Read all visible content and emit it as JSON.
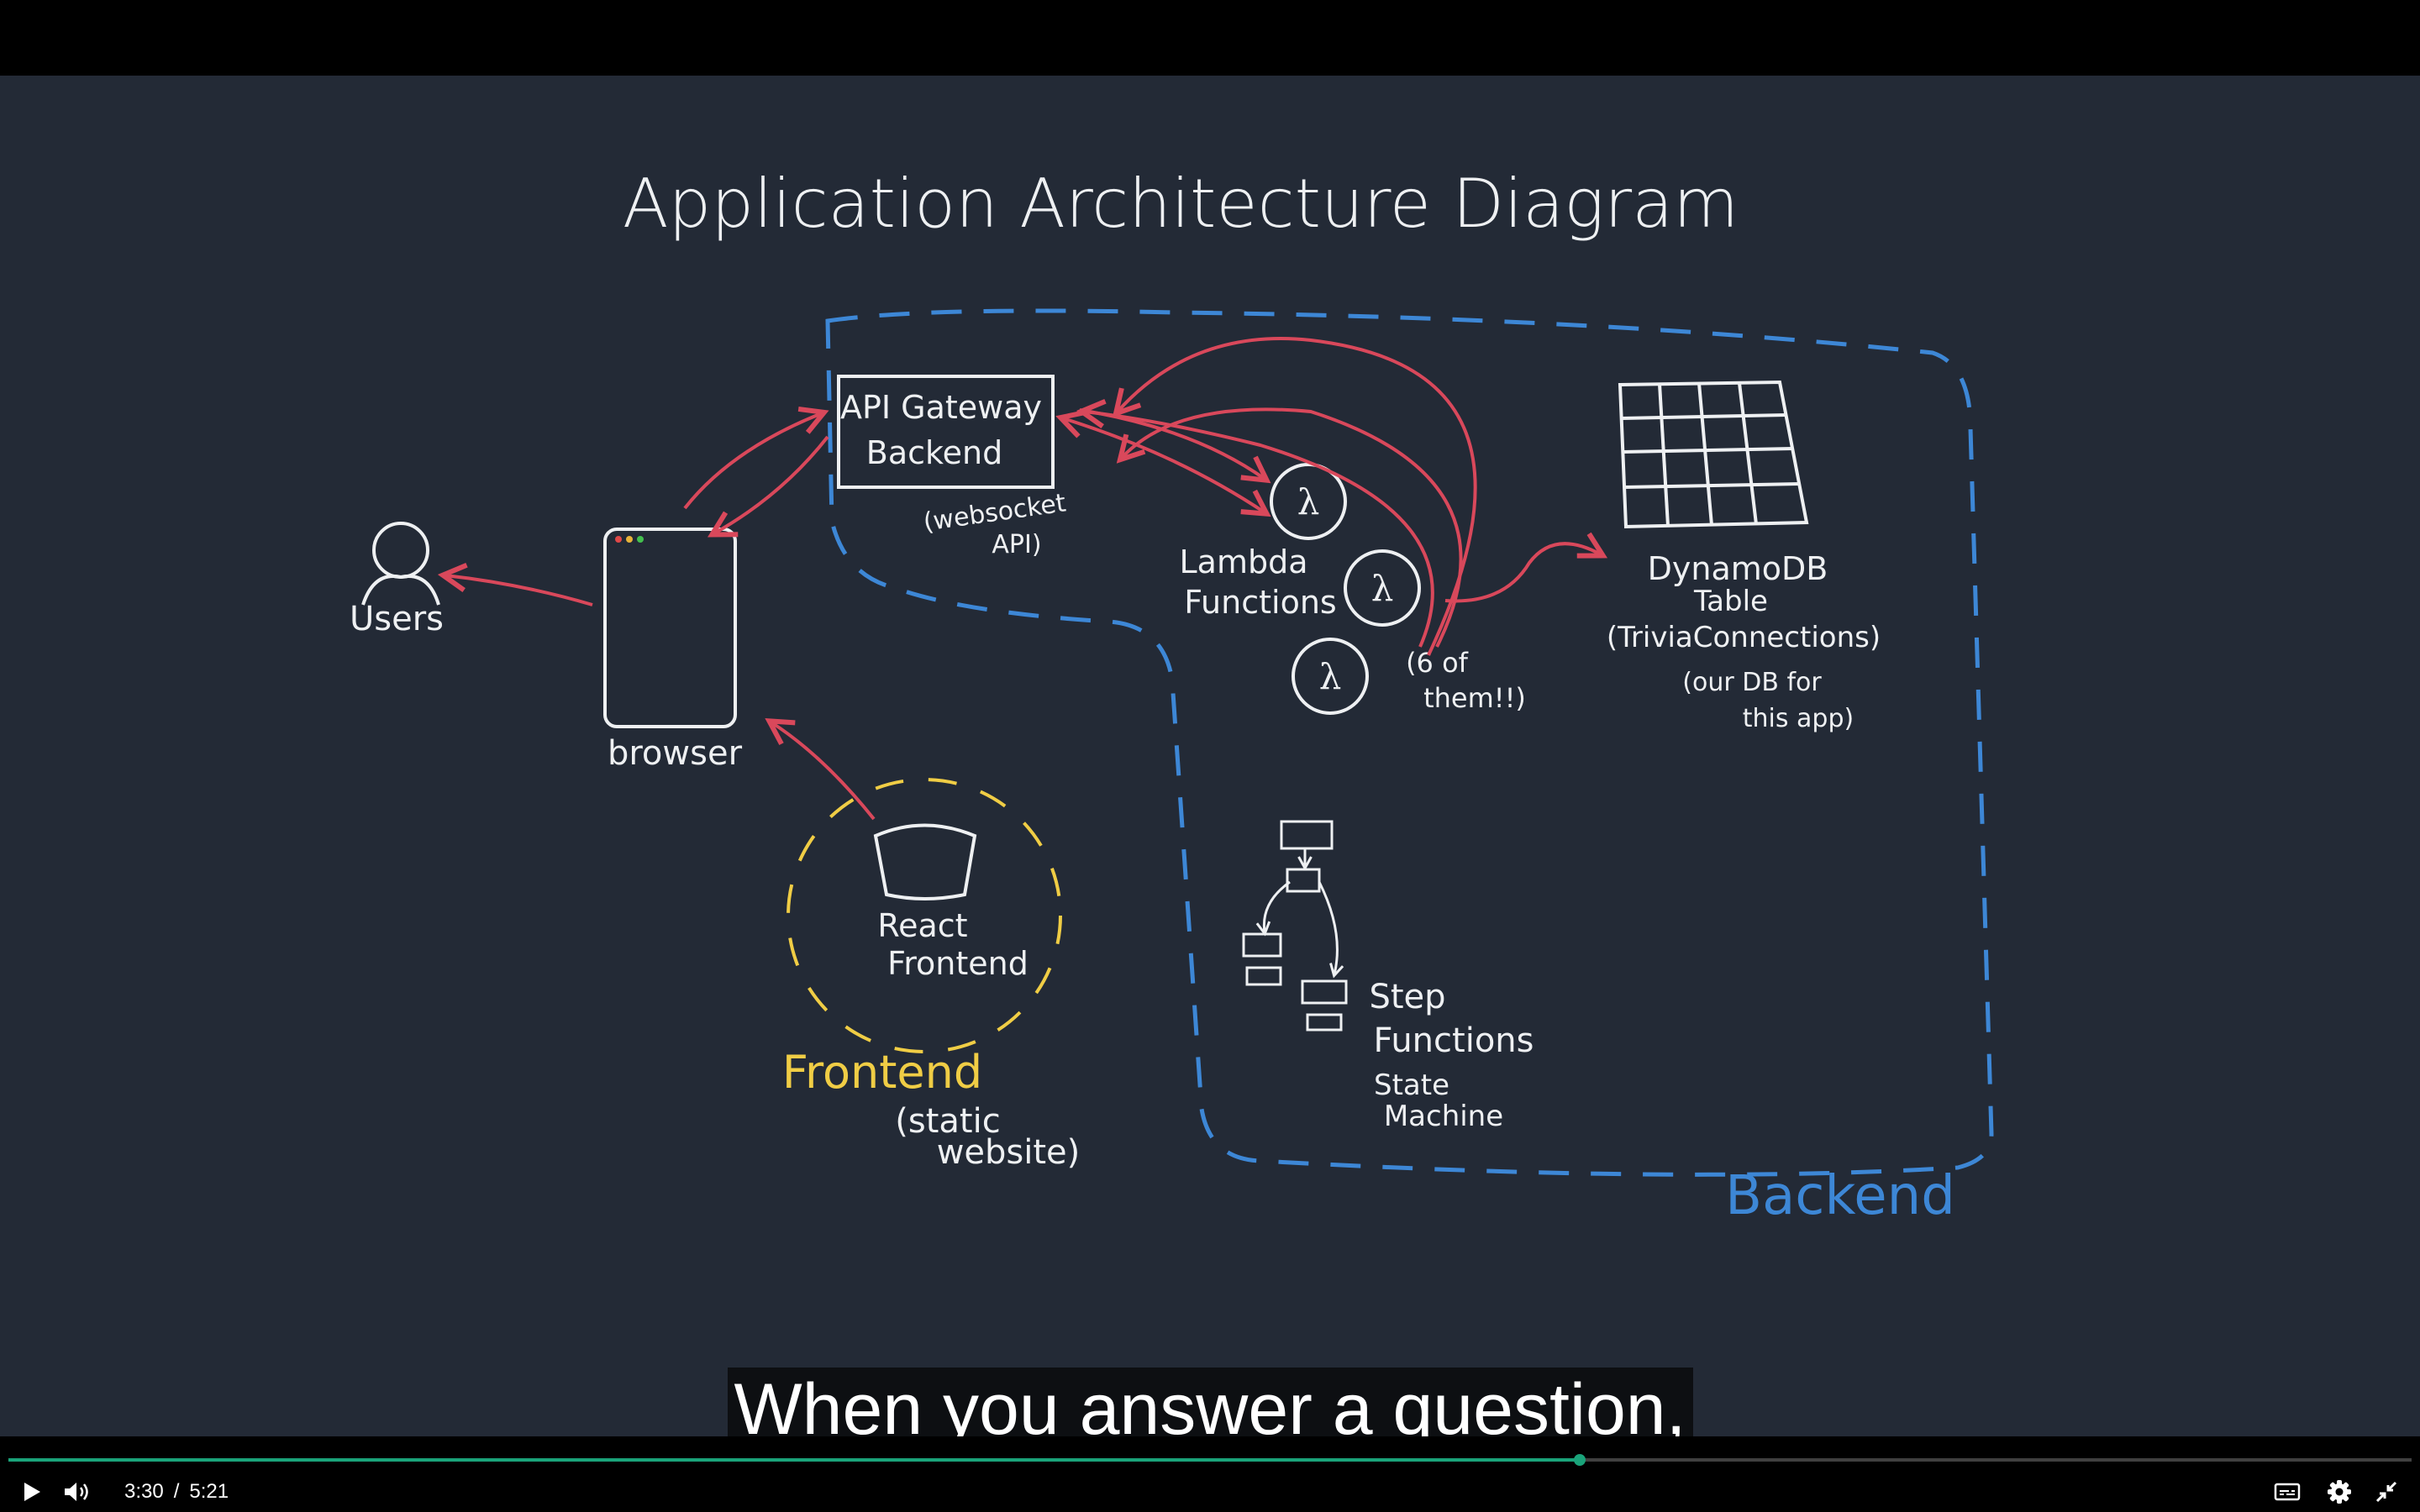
{
  "diagram": {
    "title": "Application Architecture Diagram",
    "users_label": "Users",
    "browser_label": "browser",
    "api_gateway_line1": "API Gateway",
    "api_gateway_line2": "Backend",
    "api_note_line1": "(websocket",
    "api_note_line2": "API)",
    "lambda_line1": "Lambda",
    "lambda_line2": "Functions",
    "lambda_symbol": "λ",
    "lambda_note_line1": "(6 of",
    "lambda_note_line2": "them!!)",
    "dynamo_line1": "DynamoDB",
    "dynamo_line2": "Table",
    "dynamo_line3": "(TriviaConnections)",
    "dynamo_note_line1": "(our DB for",
    "dynamo_note_line2": "this app)",
    "react_line1": "React",
    "react_line2": "Frontend",
    "frontend_label": "Frontend",
    "frontend_note_line1": "(static",
    "frontend_note_line2": "website)",
    "step_line1": "Step",
    "step_line2": "Functions",
    "step_line3": "State",
    "step_line4": "Machine",
    "backend_label": "Backend",
    "colors": {
      "background": "#232a36",
      "chalk": "#eef0f2",
      "arrow": "#d9485b",
      "backend": "#3d87d6",
      "frontend": "#f0cd45"
    }
  },
  "caption": {
    "text": "When you answer a question,"
  },
  "player": {
    "current_time": "3:30",
    "separator": "/",
    "duration": "5:21",
    "progress_fraction": 0.654,
    "icons": [
      "play-icon",
      "volume-icon",
      "captions-icon",
      "settings-icon",
      "exit-fullscreen-icon"
    ],
    "accent": "#1aa37a"
  }
}
